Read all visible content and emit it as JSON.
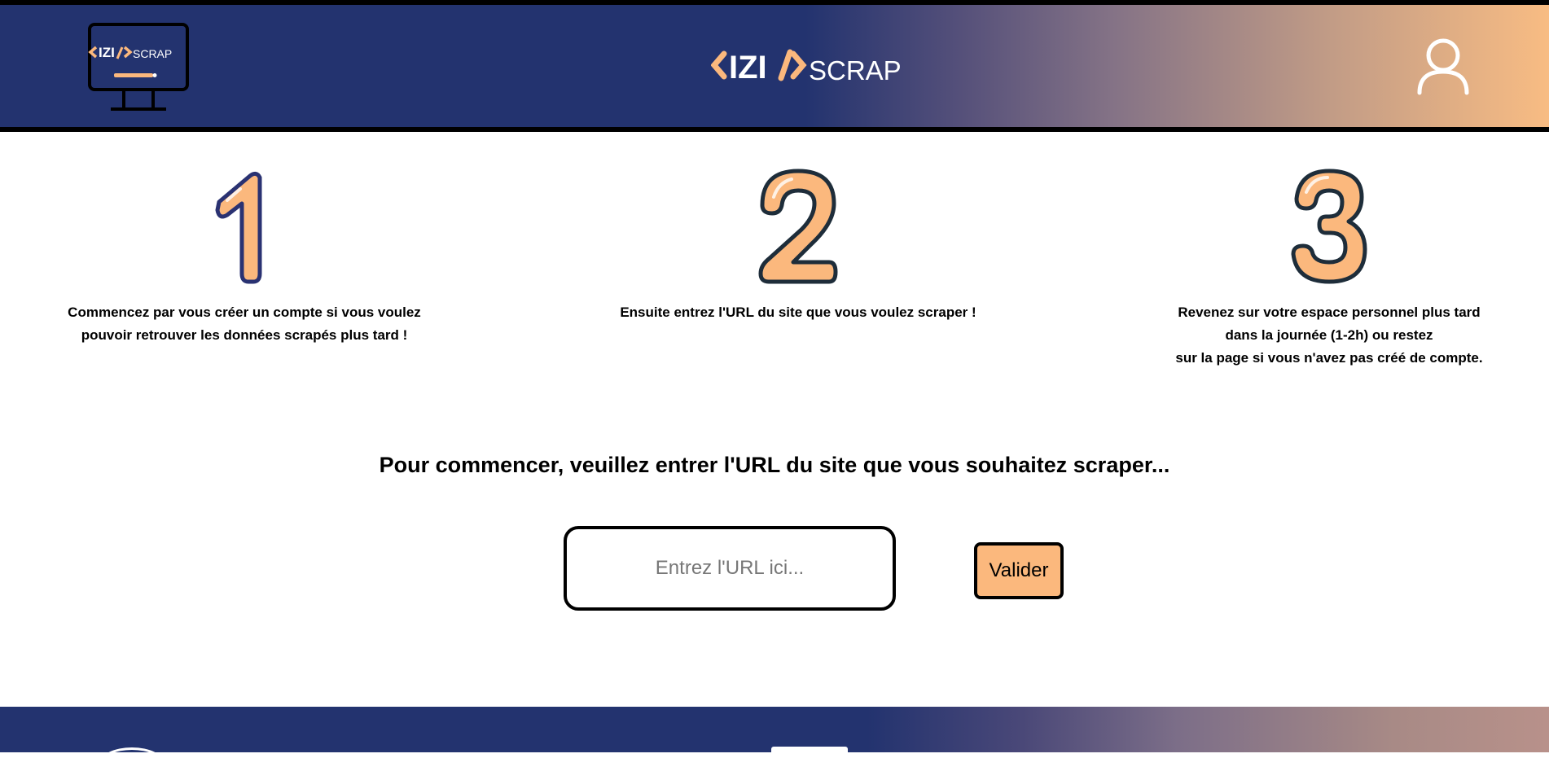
{
  "header": {
    "logo_brand": "IZI",
    "logo_suffix": "SCRAP",
    "user_button_title": "Compte"
  },
  "steps": [
    {
      "number": "1",
      "text": "Commencez par vous créer un compte si vous voulez\npouvoir retrouver les données scrapés plus tard !"
    },
    {
      "number": "2",
      "text": "Ensuite entrez l'URL du site que vous voulez scraper !"
    },
    {
      "number": "3",
      "text": "Revenez sur votre espace personnel plus tard\ndans la journée (1-2h) ou restez\nsur la page si vous n'avez pas créé de compte."
    }
  ],
  "main": {
    "prompt": "Pour commencer, veuillez entrer l'URL du site que vous souhaitez scraper...",
    "url_value": "",
    "url_placeholder": "Entrez l'URL ici...",
    "submit_label": "Valider"
  },
  "colors": {
    "navy": "#23336f",
    "peach": "#fbb87d",
    "digit_outline": "#1e2d3a"
  }
}
